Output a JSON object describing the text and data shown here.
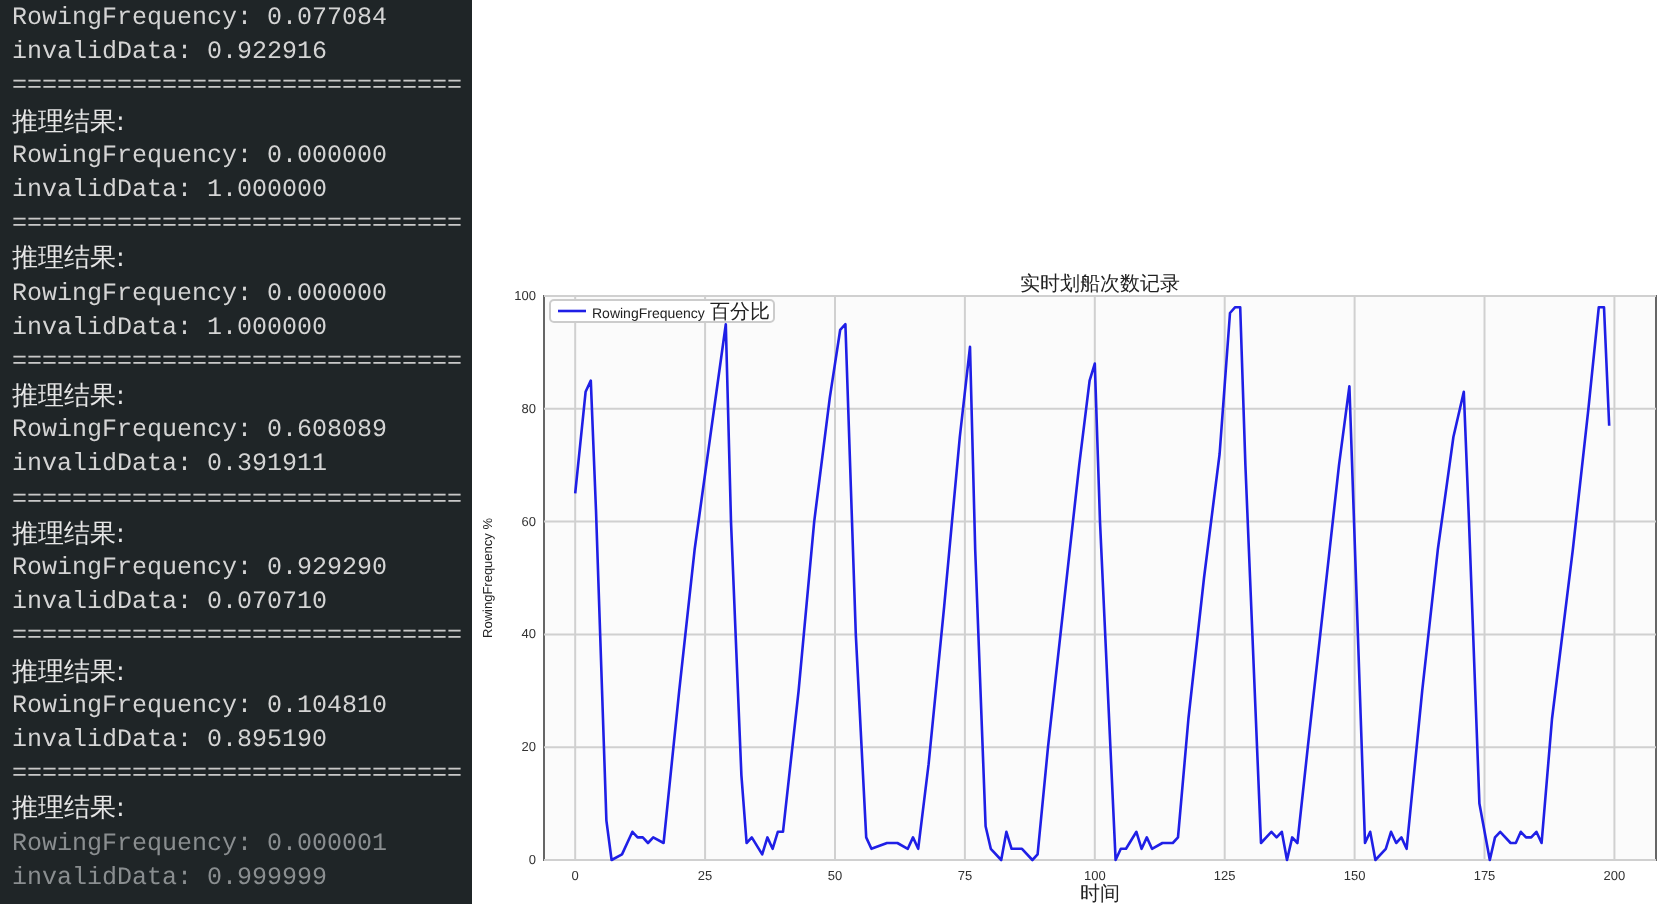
{
  "console": {
    "lines": [
      {
        "kind": "text",
        "text": "RowingFrequency: 0.077084"
      },
      {
        "kind": "text",
        "text": "invalidData: 0.922916"
      },
      {
        "kind": "separator",
        "text": "=============================="
      },
      {
        "kind": "heading",
        "text": "推理结果:"
      },
      {
        "kind": "text",
        "text": "RowingFrequency: 0.000000"
      },
      {
        "kind": "text",
        "text": "invalidData: 1.000000"
      },
      {
        "kind": "separator",
        "text": "=============================="
      },
      {
        "kind": "heading",
        "text": "推理结果:"
      },
      {
        "kind": "text",
        "text": "RowingFrequency: 0.000000"
      },
      {
        "kind": "text",
        "text": "invalidData: 1.000000"
      },
      {
        "kind": "separator",
        "text": "=============================="
      },
      {
        "kind": "heading",
        "text": "推理结果:"
      },
      {
        "kind": "text",
        "text": "RowingFrequency: 0.608089"
      },
      {
        "kind": "text",
        "text": "invalidData: 0.391911"
      },
      {
        "kind": "separator",
        "text": "=============================="
      },
      {
        "kind": "heading",
        "text": "推理结果:"
      },
      {
        "kind": "text",
        "text": "RowingFrequency: 0.929290"
      },
      {
        "kind": "text",
        "text": "invalidData: 0.070710"
      },
      {
        "kind": "separator",
        "text": "=============================="
      },
      {
        "kind": "heading",
        "text": "推理结果:"
      },
      {
        "kind": "text",
        "text": "RowingFrequency: 0.104810"
      },
      {
        "kind": "text",
        "text": "invalidData: 0.895190"
      },
      {
        "kind": "separator",
        "text": "=============================="
      },
      {
        "kind": "heading",
        "text": "推理结果:"
      },
      {
        "kind": "faded",
        "text": "RowingFrequency: 0.000001"
      },
      {
        "kind": "faded",
        "text": "invalidData: 0.999999"
      }
    ]
  },
  "chart": {
    "chart_data": {
      "type": "line",
      "title": "实时划船次数记录",
      "xlabel": "时间",
      "ylabel": "RowingFrequency %",
      "x": [
        0,
        2,
        3,
        4,
        6,
        7,
        9,
        11,
        12,
        13,
        14,
        15,
        17,
        20,
        23,
        26,
        29,
        30,
        32,
        33,
        34,
        36,
        37,
        38,
        39,
        40,
        43,
        46,
        49,
        51,
        52,
        54,
        56,
        57,
        60,
        62,
        64,
        65,
        66,
        68,
        71,
        74,
        76,
        77,
        79,
        80,
        82,
        83,
        84,
        86,
        88,
        89,
        91,
        94,
        97,
        99,
        100,
        101,
        104,
        105,
        106,
        108,
        109,
        110,
        111,
        113,
        115,
        116,
        118,
        121,
        124,
        126,
        127,
        128,
        129,
        132,
        134,
        135,
        136,
        137,
        138,
        139,
        141,
        144,
        147,
        149,
        151,
        152,
        153,
        154,
        156,
        157,
        158,
        159,
        160,
        163,
        166,
        169,
        171,
        172,
        174,
        176,
        177,
        178,
        180,
        181,
        182,
        183,
        184,
        185,
        186,
        188,
        192,
        195,
        197,
        198,
        199
      ],
      "series": [
        {
          "name": "RowingFrequency 百分比",
          "color": "#1f1fe6",
          "values": [
            65,
            83,
            85,
            62,
            7,
            0,
            1,
            5,
            4,
            4,
            3,
            4,
            3,
            30,
            55,
            75,
            95,
            60,
            15,
            3,
            4,
            1,
            4,
            2,
            5,
            5,
            30,
            60,
            82,
            94,
            95,
            40,
            4,
            2,
            3,
            3,
            2,
            4,
            2,
            17,
            45,
            75,
            91,
            55,
            6,
            2,
            0,
            5,
            2,
            2,
            0,
            1,
            20,
            45,
            70,
            85,
            88,
            60,
            0,
            2,
            2,
            5,
            2,
            4,
            2,
            3,
            3,
            4,
            25,
            50,
            72,
            97,
            98,
            98,
            70,
            3,
            5,
            4,
            5,
            0,
            4,
            3,
            20,
            45,
            70,
            84,
            30,
            3,
            5,
            0,
            2,
            5,
            3,
            4,
            2,
            30,
            55,
            75,
            83,
            60,
            10,
            0,
            4,
            5,
            3,
            3,
            5,
            4,
            4,
            5,
            3,
            25,
            55,
            80,
            98,
            98,
            77
          ]
        }
      ],
      "grid": true,
      "xlim": [
        -6,
        208
      ],
      "ylim": [
        0,
        100
      ],
      "xticks": [
        0,
        25,
        50,
        75,
        100,
        125,
        150,
        175,
        200
      ],
      "yticks": [
        0,
        20,
        40,
        60,
        80,
        100
      ]
    }
  }
}
